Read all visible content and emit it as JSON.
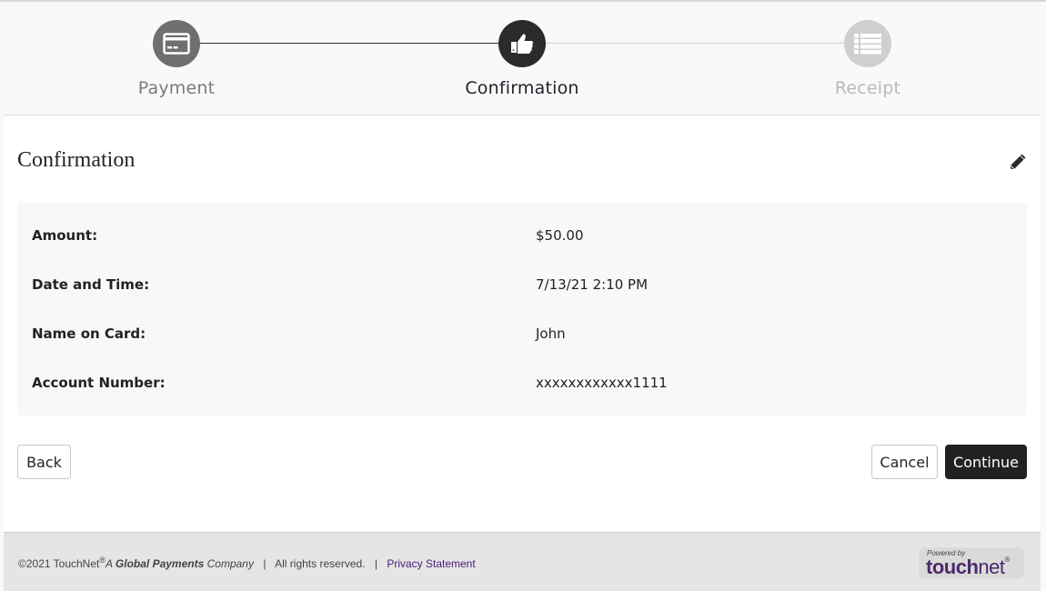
{
  "stepper": {
    "steps": [
      {
        "label": "Payment",
        "icon": "credit-card-icon",
        "state": "completed"
      },
      {
        "label": "Confirmation",
        "icon": "thumbs-up-icon",
        "state": "active"
      },
      {
        "label": "Receipt",
        "icon": "list-icon",
        "state": "pending"
      }
    ]
  },
  "card": {
    "title": "Confirmation",
    "edit_icon": "pencil-icon",
    "details": [
      {
        "label": "Amount:",
        "value": "$50.00"
      },
      {
        "label": "Date and Time:",
        "value": "7/13/21 2:10 PM"
      },
      {
        "label": "Name on Card:",
        "value": "John"
      },
      {
        "label": "Account Number:",
        "value": "xxxxxxxxxxxx1111"
      }
    ],
    "buttons": {
      "back": "Back",
      "cancel": "Cancel",
      "continue": "Continue"
    }
  },
  "footer": {
    "copyright": "©2021 TouchNet",
    "registered": "®",
    "tagline_a": "A ",
    "tagline_bold": "Global Payments",
    "tagline_b": " Company",
    "separator": "|",
    "rights": "All rights reserved.",
    "privacy_link": "Privacy Statement",
    "powered_by": "Powered by",
    "brand_bold": "touch",
    "brand_light": "net",
    "brand_mark": "®"
  },
  "colors": {
    "active_step": "#2b2b2b",
    "completed_step": "#6f6f6f",
    "pending_step": "#cfcfcf",
    "primary_button": "#212121",
    "privacy_link": "#4b1a7a",
    "brand": "#4b2a6b"
  }
}
